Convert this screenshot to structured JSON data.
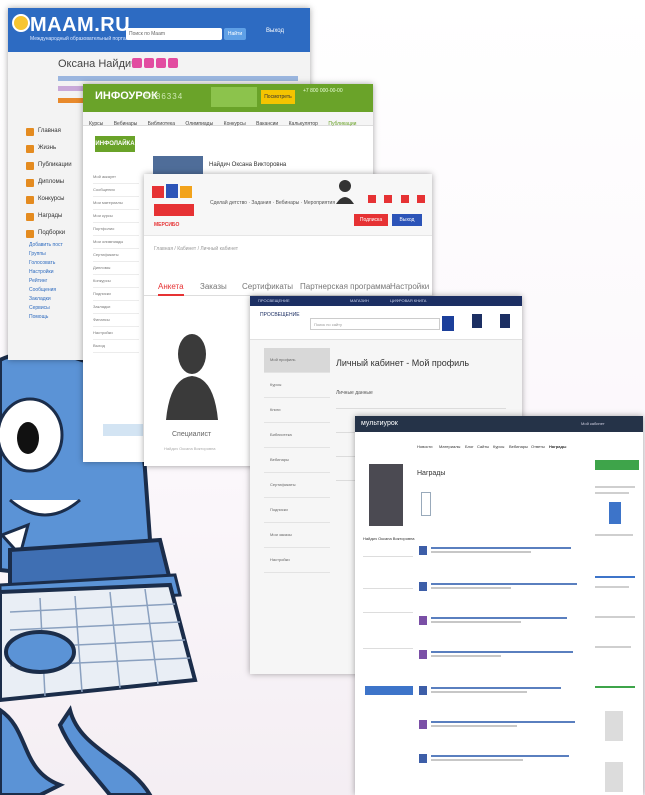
{
  "shot_maam": {
    "logo": "MAAM.RU",
    "tagline": "Международный образовательный портал",
    "search_placeholder": "Поиск по Maam",
    "search_button": "Найти",
    "login": "Выход",
    "user_name": "Оксана Найдич",
    "sidebar": [
      "Главная",
      "Жизнь",
      "Публикации",
      "Дипломы",
      "Конкурсы",
      "Награды",
      "Подборки"
    ],
    "sidebar_links": [
      "Добавить пост",
      "Группы",
      "Голосовать",
      "Настройки",
      "Рейтинг",
      "Сообщения",
      "Закладки",
      "Сервисы",
      "Помощь"
    ]
  },
  "shot_infourok": {
    "brand": "ИНФОУРОК",
    "counter": "5186334",
    "yellow_button": "Посмотреть",
    "phone": "+7 800 000-00-00",
    "menu": [
      "Курсы",
      "Вебинары",
      "Библиотека",
      "Олимпиады",
      "Конкурсы",
      "Вакансии",
      "Калькулятор",
      "Публикации"
    ],
    "badge": "ИНФОЛАЙКА",
    "user_name": "Найдич Оксана Викторовна",
    "sidebar": [
      "Мой аккаунт",
      "Сообщения",
      "Мои материалы",
      "Мои курсы",
      "Портфолио",
      "Мои олимпиады",
      "Сертификаты",
      "Дипломы",
      "Конкурсы",
      "Подписки",
      "Закладки",
      "Финансы",
      "Настройки",
      "Выход"
    ]
  },
  "shot_mersibo": {
    "logo": "МЕРСИБО",
    "links": "Сделай детство · Задания · Вебинары · Мероприятия",
    "btn_red": "Подписка",
    "btn_blue": "Выход",
    "breadcrumb": "Главная / Кабинет / Личный кабинет",
    "tabs": [
      "Анкета",
      "Заказы",
      "Сертификаты",
      "Партнерская программа",
      "Настройки"
    ],
    "role": "Специалист",
    "role_sub": "Найдич Оксана Викторовна"
  },
  "shot_prosv": {
    "bar": [
      "ПРОСВЕЩЕНИЕ",
      "МАГАЗИН",
      "ЦИФРОВАЯ КНИГА"
    ],
    "logo": "ПРОСВЕЩЕНИЕ",
    "search_placeholder": "Поиск по сайту",
    "sidebar": [
      "Мой профиль",
      "Курсы",
      "Книги",
      "Библиотека",
      "Вебинары",
      "Сертификаты",
      "Подписки",
      "Мои заказы",
      "Настройки"
    ],
    "title": "Личный кабинет - Мой профиль",
    "section": "Личные данные"
  },
  "shot_multiurok": {
    "logo": "мультиурок",
    "top_right": "Мой кабинет",
    "menu": [
      "Новости",
      "Материалы",
      "Блог",
      "Сайты",
      "Курсы",
      "Вебинары",
      "Ответы",
      "Награды"
    ],
    "title": "Награды",
    "user_name": "Найдич Оксана Викторовна"
  }
}
